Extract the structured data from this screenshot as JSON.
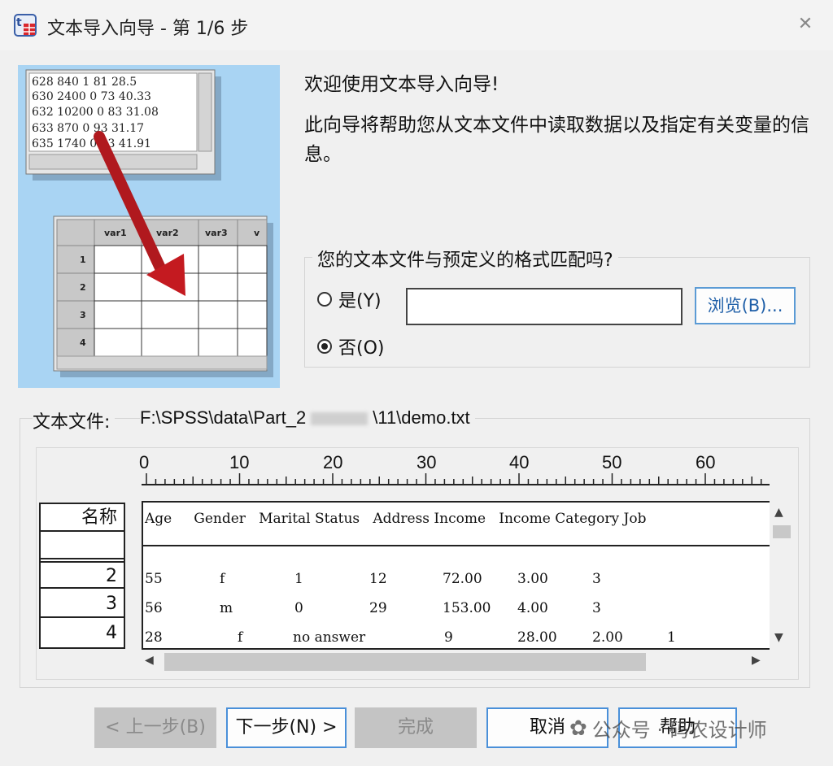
{
  "window": {
    "title": "文本导入向导 - 第 1/6 步"
  },
  "illustration": {
    "text_lines": [
      "628 840 1 81 28.5",
      "630 2400 0 73 40.33",
      "632 10200 0 83 31.08",
      "633 870 0 93 31.17",
      "635 1740 0 83 41.91"
    ],
    "grid_headers": [
      "var1",
      "var2",
      "var3",
      "v"
    ],
    "grid_rows": [
      "1",
      "2",
      "3",
      "4"
    ]
  },
  "welcome": "欢迎使用文本导入向导!",
  "description": "此向导将帮助您从文本文件中读取数据以及指定有关变量的信息。",
  "format_group": {
    "legend": "您的文本文件与预定义的格式匹配吗?",
    "yes_label": "是(Y)",
    "no_label": "否(O)",
    "selected": "no",
    "path_value": "",
    "browse_label": "浏览(B)..."
  },
  "file": {
    "label": "文本文件:",
    "path_prefix": "F:\\SPSS\\data\\Part_2",
    "path_suffix": "\\11\\demo.txt"
  },
  "ruler": {
    "labels": [
      "0",
      "10",
      "20",
      "30",
      "40",
      "50",
      "60"
    ]
  },
  "preview": {
    "name_header": "名称",
    "row_numbers": [
      "",
      "2",
      "3",
      "4"
    ],
    "header_line": "Age     Gender   Marital Status   Address Income   Income Category Job",
    "rows": [
      [
        "55",
        "f",
        "1",
        "12",
        "72.00",
        "3.00",
        "3"
      ],
      [
        "56",
        "m",
        "0",
        "29",
        "153.00",
        "4.00",
        "3"
      ],
      [
        "28",
        "f",
        "no answer",
        "9",
        "28.00",
        "2.00",
        "1"
      ]
    ]
  },
  "buttons": {
    "back": "< 上一步(B)",
    "next": "下一步(N) >",
    "finish": "完成",
    "cancel": "取消",
    "help": "帮助"
  },
  "watermark": "公众号 · 码农设计师"
}
